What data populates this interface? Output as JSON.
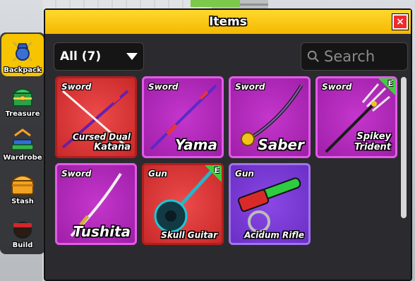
{
  "window": {
    "title": "Items"
  },
  "filter": {
    "label": "All (7)"
  },
  "search": {
    "placeholder": "Search"
  },
  "sidebar": {
    "items": [
      {
        "label": "Backpack",
        "icon": "backpack-icon",
        "active": true
      },
      {
        "label": "Treasure",
        "icon": "treasure-icon",
        "active": false
      },
      {
        "label": "Wardrobe",
        "icon": "wardrobe-icon",
        "active": false
      },
      {
        "label": "Stash",
        "icon": "stash-icon",
        "active": false
      },
      {
        "label": "Build",
        "icon": "build-icon",
        "active": false
      }
    ]
  },
  "items": [
    {
      "type": "Sword",
      "name_line1": "Cursed Dual",
      "name_line2": "Katana",
      "rarity_color": "#c82929",
      "equipped": false
    },
    {
      "type": "Sword",
      "name": "Yama",
      "rarity_color": "#9f1fa8",
      "equipped": false
    },
    {
      "type": "Sword",
      "name": "Saber",
      "rarity_color": "#9f1fa8",
      "equipped": false
    },
    {
      "type": "Sword",
      "name_line1": "Spikey",
      "name_line2": "Trident",
      "rarity_color": "#9f1fa8",
      "equipped": true,
      "badge": "E"
    },
    {
      "type": "Sword",
      "name": "Tushita",
      "rarity_color": "#9f1fa8",
      "equipped": false
    },
    {
      "type": "Gun",
      "name": "Skull Guitar",
      "rarity_color": "#c82929",
      "equipped": true,
      "badge": "E"
    },
    {
      "type": "Gun",
      "name": "Acidum Rifle",
      "rarity_color": "#6a2fc6",
      "equipped": false
    }
  ],
  "close": {
    "label": "×"
  },
  "colors": {
    "title_bar": "#f4b800",
    "equipped_badge": "#3ecf3e",
    "mythical": "#c82929",
    "legendary": "#9f1fa8"
  }
}
